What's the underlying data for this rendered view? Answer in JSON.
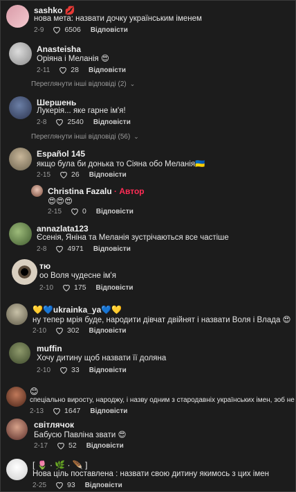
{
  "comments": [
    {
      "name": "sashko 💋",
      "text": "нова мета: назвати дочку українським іменем",
      "date": "2-9",
      "likes": "6506",
      "reply": "Відповісти"
    },
    {
      "name": "Anasteisha",
      "text": "Оріяна і Меланія 😍",
      "date": "2-11",
      "likes": "28",
      "reply": "Відповісти",
      "more": "Переглянути інші відповіді (2)"
    },
    {
      "name": "Шершень",
      "text": "Лукерія... яке гарне ім'я!",
      "date": "2-8",
      "likes": "2540",
      "reply": "Відповісти",
      "more": "Переглянути інші відповіді (56)"
    },
    {
      "name": "Español 145",
      "text": "якщо була би донька то Сіяна обо Меланія🇺🇦",
      "date": "2-15",
      "likes": "26",
      "reply": "Відповісти"
    },
    {
      "name": "Christina Fazalu",
      "author": "· Автор",
      "text": "😍😍😍",
      "date": "2-15",
      "likes": "0",
      "reply": "Відповісти"
    },
    {
      "name": "annazlata123",
      "text": "Єсенія, Яніна та Меланія зустрічаються все частіше",
      "date": "2-8",
      "likes": "4971",
      "reply": "Відповісти"
    },
    {
      "name": "тю",
      "text": "оо Воля чудесне ім'я",
      "date": "2-10",
      "likes": "175",
      "reply": "Відповісти"
    },
    {
      "name": "💛💙ukrainka_ya💙💛",
      "text": "ну тепер мрія буде, народити дівчат двійнят і назвати Воля і Влада 😍",
      "date": "2-10",
      "likes": "302",
      "reply": "Відповісти"
    },
    {
      "name": "muffin",
      "text": "Хочу дитину щоб назвати її доляна",
      "date": "2-10",
      "likes": "33",
      "reply": "Відповісти"
    },
    {
      "name": "😊",
      "text": "спеціально виросту, народжу, і назву одним з стародавніх українських імен, зоб не ослаблялися",
      "date": "2-13",
      "likes": "1647",
      "reply": "Відповісти"
    },
    {
      "name": "світлячок",
      "text": "Бабусю Павліна звати 😍",
      "date": "2-17",
      "likes": "52",
      "reply": "Відповісти"
    },
    {
      "name": "[ 🌷 · 🌿 · 🪶 ]",
      "text": "Нова ціль поставлена : назвати свою дитину якимось з цих імен",
      "date": "2-25",
      "likes": "93",
      "reply": "Відповісти"
    }
  ],
  "colors": {
    "background": "#1c1c1c",
    "author_accent": "#fe2c55",
    "text": "#e6e6e6",
    "muted": "#9a9a9a"
  },
  "icons": {
    "like": "heart-outline-icon",
    "expand": "chevron-down-icon"
  }
}
